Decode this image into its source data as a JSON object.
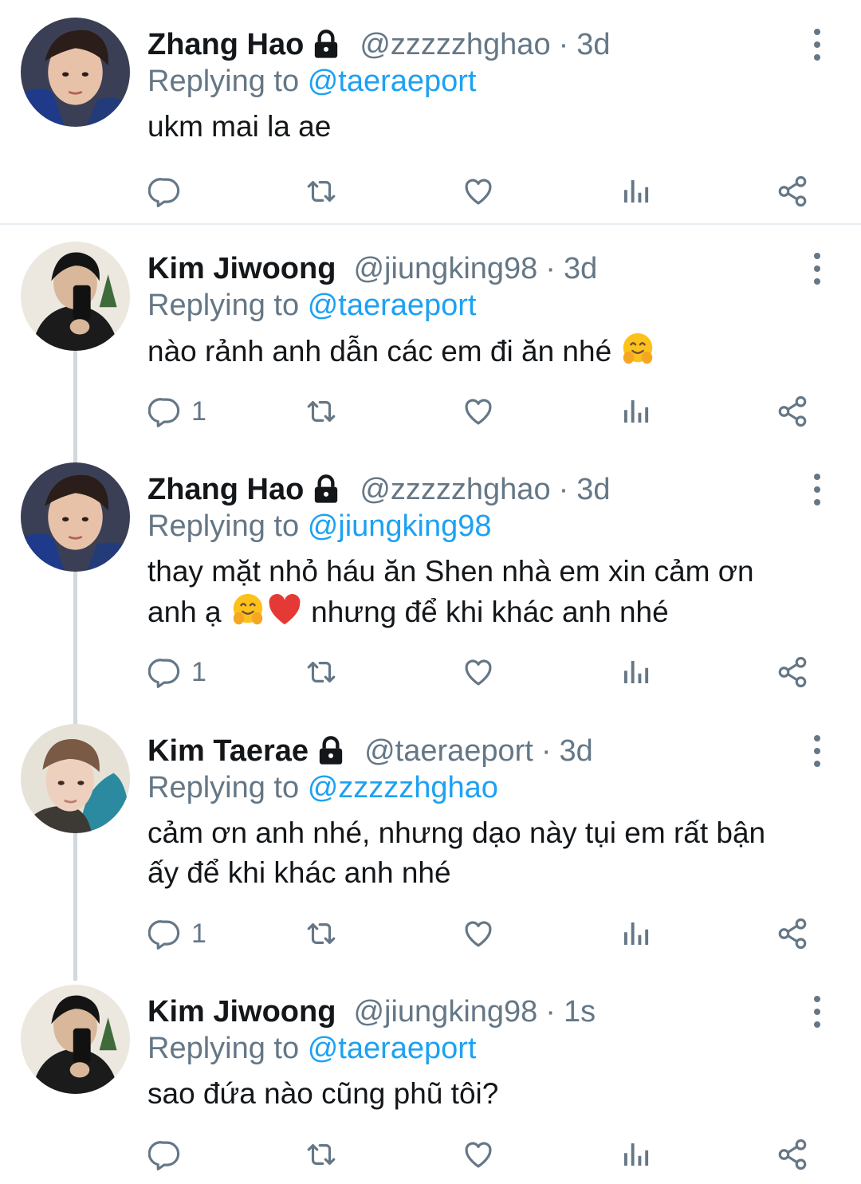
{
  "colors": {
    "text": "#14171a",
    "secondary": "#657786",
    "link": "#1da1f2",
    "thread_line": "#cfd9de",
    "divider": "#e6ecf0"
  },
  "tweets": [
    {
      "name": "Zhang Hao",
      "protected": true,
      "handle": "@zzzzzhghao",
      "dot": "·",
      "time": "3d",
      "replying_prefix": "Replying to",
      "replying_to": "@taeraeport",
      "text_lines": [
        "ukm mai la ae"
      ],
      "reply_count": "",
      "icons": [
        "reply-icon",
        "retweet-icon",
        "like-icon",
        "analytics-icon",
        "share-icon"
      ]
    },
    {
      "name": "Kim Jiwoong",
      "protected": false,
      "handle": "@jiungking98",
      "dot": "·",
      "time": "3d",
      "replying_prefix": "Replying to",
      "replying_to": "@taeraeport",
      "text_lines": [
        "nào rảnh anh dẫn các em đi ăn nhé"
      ],
      "reply_count": "1"
    },
    {
      "name": "Zhang Hao",
      "protected": true,
      "handle": "@zzzzzhghao",
      "dot": "·",
      "time": "3d",
      "replying_prefix": "Replying to",
      "replying_to": "@jiungking98",
      "text_lines": [
        "thay mặt nhỏ háu ăn Shen nhà em xin cảm ơn",
        "anh ạ",
        "nhưng để khi khác anh nhé"
      ],
      "reply_count": "1"
    },
    {
      "name": "Kim Taerae",
      "protected": true,
      "handle": "@taeraeport",
      "dot": "·",
      "time": "3d",
      "replying_prefix": "Replying to",
      "replying_to": "@zzzzzhghao",
      "text_lines": [
        "cảm ơn anh nhé, nhưng dạo này tụi em rất bận",
        "ấy để khi khác anh nhé"
      ],
      "reply_count": "1"
    },
    {
      "name": "Kim Jiwoong",
      "protected": false,
      "handle": "@jiungking98",
      "dot": "·",
      "time": "1s",
      "replying_prefix": "Replying to",
      "replying_to": "@taeraeport",
      "text_lines": [
        "sao đứa nào cũng phũ tôi?"
      ],
      "reply_count": ""
    }
  ]
}
